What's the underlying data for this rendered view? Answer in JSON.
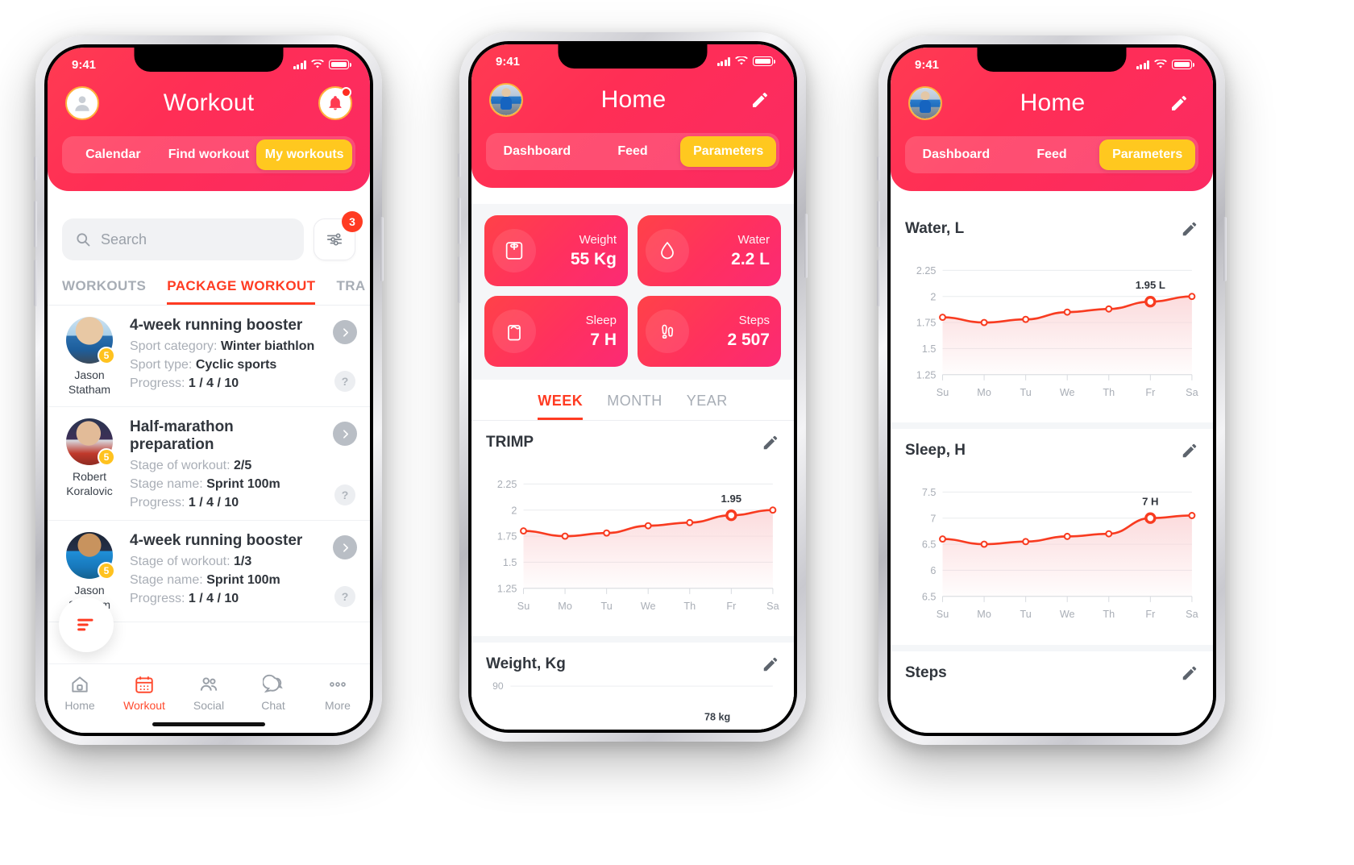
{
  "status_bar": {
    "time": "9:41"
  },
  "phone1": {
    "header": {
      "title": "Workout",
      "avatar_icon": "person-icon",
      "bell_icon": "bell-icon"
    },
    "segments": [
      {
        "label": "Calendar",
        "active": false
      },
      {
        "label": "Find workout",
        "active": false
      },
      {
        "label": "My workouts",
        "active": true
      }
    ],
    "search": {
      "placeholder": "Search",
      "icon": "search-icon",
      "filter_icon": "sliders-icon",
      "filter_badge": "3"
    },
    "tabs": [
      {
        "label": "WORKOUTS",
        "active": false
      },
      {
        "label": "PACKAGE WORKOUT",
        "active": true
      },
      {
        "label": "TRA",
        "active": false
      }
    ],
    "workouts": [
      {
        "title": "4-week running booster",
        "author": "Jason Statham",
        "level": "5",
        "rows": [
          {
            "label": "Sport category:",
            "value": "Winter biathlon"
          },
          {
            "label": "Sport type:",
            "value": "Cyclic sports"
          },
          {
            "label": "Progress:",
            "value": "1 / 4 / 10"
          }
        ]
      },
      {
        "title": "Half-marathon preparation",
        "author": "Robert Koralovic",
        "level": "5",
        "rows": [
          {
            "label": "Stage of workout:",
            "value": "2/5"
          },
          {
            "label": "Stage name:",
            "value": "Sprint 100m"
          },
          {
            "label": "Progress:",
            "value": "1 / 4 / 10"
          }
        ]
      },
      {
        "title": "4-week running booster",
        "author": "Jason Statham",
        "level": "5",
        "rows": [
          {
            "label": "Stage of workout:",
            "value": "1/3"
          },
          {
            "label": "Stage name:",
            "value": "Sprint 100m"
          },
          {
            "label": "Progress:",
            "value": "1 / 4 / 10"
          }
        ]
      }
    ],
    "help_label": "?",
    "fab_icon": "filter-lines-icon",
    "tabbar": [
      {
        "label": "Home",
        "icon": "home-icon",
        "active": false
      },
      {
        "label": "Workout",
        "icon": "calendar-icon",
        "active": true
      },
      {
        "label": "Social",
        "icon": "people-icon",
        "active": false
      },
      {
        "label": "Chat",
        "icon": "chat-icon",
        "active": false
      },
      {
        "label": "More",
        "icon": "dots-icon",
        "active": false
      }
    ]
  },
  "phone2": {
    "header": {
      "title": "Home",
      "avatar_icon": "runner-avatar",
      "edit_icon": "pencil-icon"
    },
    "segments": [
      {
        "label": "Dashboard",
        "active": false
      },
      {
        "label": "Feed",
        "active": false
      },
      {
        "label": "Parameters",
        "active": true
      }
    ],
    "metric_cards": [
      {
        "label": "Weight",
        "value": "55 Kg",
        "icon": "scale-icon"
      },
      {
        "label": "Water",
        "value": "2.2 L",
        "icon": "droplet-icon"
      },
      {
        "label": "Sleep",
        "value": "7 H",
        "icon": "bed-icon"
      },
      {
        "label": "Steps",
        "value": "2 507",
        "icon": "footsteps-icon"
      }
    ],
    "period_tabs": [
      {
        "label": "WEEK",
        "active": true
      },
      {
        "label": "MONTH",
        "active": false
      },
      {
        "label": "YEAR",
        "active": false
      }
    ],
    "sections": [
      {
        "title": "TRIMP",
        "edit_icon": "pencil-icon"
      },
      {
        "title": "Weight, Kg",
        "edit_icon": "pencil-icon"
      }
    ],
    "weight_chart_peek": {
      "ytop": "90",
      "annotation": "78 kg"
    }
  },
  "phone3": {
    "header": {
      "title": "Home",
      "avatar_icon": "runner-avatar",
      "edit_icon": "pencil-icon"
    },
    "segments": [
      {
        "label": "Dashboard",
        "active": false
      },
      {
        "label": "Feed",
        "active": false
      },
      {
        "label": "Parameters",
        "active": true
      }
    ],
    "sections": [
      {
        "title": "Water, L",
        "edit_icon": "pencil-icon"
      },
      {
        "title": "Sleep, H",
        "edit_icon": "pencil-icon"
      },
      {
        "title": "Steps",
        "edit_icon": "pencil-icon"
      }
    ]
  },
  "chart_data": [
    {
      "id": "trimp",
      "type": "area",
      "title": "TRIMP",
      "xlabel": "",
      "ylabel": "",
      "categories": [
        "Su",
        "Mo",
        "Tu",
        "We",
        "Th",
        "Fr",
        "Sa"
      ],
      "values": [
        1.8,
        1.75,
        1.78,
        1.85,
        1.88,
        1.95,
        2.0
      ],
      "yticks": [
        "2.25",
        "2",
        "1.75",
        "1.5",
        "1.25"
      ],
      "ylim": [
        1.25,
        2.25
      ],
      "annotation": {
        "label": "1.95",
        "index": 5,
        "value": 1.95
      },
      "grid": true,
      "legend": "none",
      "line_color": "#f83b20",
      "fill_color": "#fbd5d7"
    },
    {
      "id": "water",
      "type": "area",
      "title": "Water, L",
      "xlabel": "",
      "ylabel": "",
      "categories": [
        "Su",
        "Mo",
        "Tu",
        "We",
        "Th",
        "Fr",
        "Sa"
      ],
      "values": [
        1.8,
        1.75,
        1.78,
        1.85,
        1.88,
        1.95,
        2.0
      ],
      "yticks": [
        "2.25",
        "2",
        "1.75",
        "1.5",
        "1.25"
      ],
      "ylim": [
        1.25,
        2.25
      ],
      "annotation": {
        "label": "1.95 L",
        "index": 5,
        "value": 1.95
      },
      "grid": true,
      "legend": "none",
      "line_color": "#f83b20",
      "fill_color": "#fbd5d7"
    },
    {
      "id": "sleep",
      "type": "area",
      "title": "Sleep, H",
      "xlabel": "",
      "ylabel": "",
      "categories": [
        "Su",
        "Mo",
        "Tu",
        "We",
        "Th",
        "Fr",
        "Sa"
      ],
      "values": [
        6.6,
        6.5,
        6.55,
        6.65,
        6.7,
        7.0,
        7.05
      ],
      "yticks": [
        "7.5",
        "7",
        "6.5",
        "6",
        "6.5"
      ],
      "ylim": [
        5.5,
        7.5
      ],
      "annotation": {
        "label": "7 H",
        "index": 5,
        "value": 7.0
      },
      "grid": true,
      "legend": "none",
      "line_color": "#f83b20",
      "fill_color": "#fbd5d7"
    }
  ]
}
